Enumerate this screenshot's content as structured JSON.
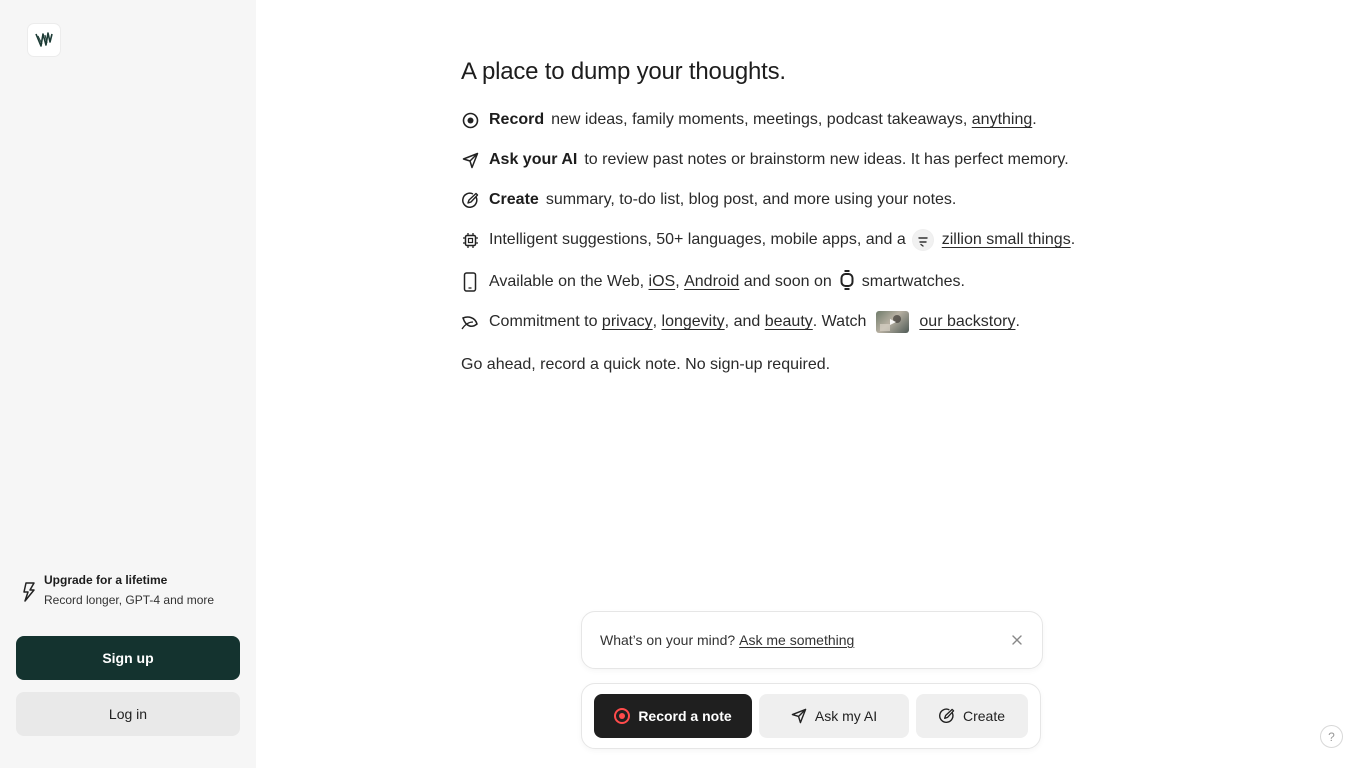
{
  "sidebar": {
    "logo_icon": "brand-logo-icon",
    "upgrade": {
      "title": "Upgrade for a lifetime",
      "subtitle": "Record longer, GPT-4 and more",
      "icon": "lightning-icon"
    },
    "signup_label": "Sign up",
    "login_label": "Log in"
  },
  "main": {
    "headline": "A place to dump your thoughts.",
    "features": [
      {
        "icon": "record-icon",
        "bold": "Record",
        "text": "new ideas, family moments, meetings, podcast takeaways,",
        "link": "anything",
        "end": "."
      },
      {
        "icon": "send-icon",
        "bold": "Ask your AI",
        "text": "to review past notes or brainstorm new ideas. It has perfect memory."
      },
      {
        "icon": "create-icon",
        "bold": "Create",
        "text": "summary, to-do list, blog post, and more using your notes."
      },
      {
        "icon": "chip-icon",
        "text": "Intelligent suggestions, 50+ languages, mobile apps, and a",
        "link": "zillion small things",
        "end": "."
      },
      {
        "icon": "phone-icon",
        "text_a": "Available on the Web,",
        "link_ios": "iOS",
        "comma": ",",
        "link_android": "Android",
        "text_b": "and soon on",
        "text_c": "smartwatches."
      },
      {
        "icon": "leaf-icon",
        "text_a": "Commitment to",
        "link_privacy": "privacy",
        "sep1": ",",
        "link_longevity": "longevity",
        "sep2": ", and",
        "link_beauty": "beauty",
        "text_b": ". Watch",
        "link_backstory": "our backstory",
        "end": "."
      }
    ],
    "closing": "Go ahead, record a quick note. No sign-up required."
  },
  "prompt": {
    "text": "What’s on your mind?",
    "link": "Ask me something"
  },
  "actions": {
    "record_label": "Record a note",
    "ask_label": "Ask my AI",
    "create_label": "Create"
  },
  "help_label": "?",
  "colors": {
    "sidebar_bg": "#f6f6f6",
    "signup_bg": "#14332f",
    "record_bg": "#1f1f1f",
    "record_accent": "#ff4b4b"
  }
}
